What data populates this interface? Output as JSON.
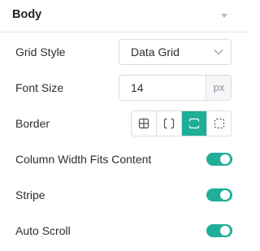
{
  "panel": {
    "title": "Body",
    "collapse_icon": "caret-down-icon"
  },
  "grid_style": {
    "label": "Grid Style",
    "value": "Data Grid",
    "icon": "chevron-down-icon"
  },
  "font_size": {
    "label": "Font Size",
    "value": "14",
    "unit": "px"
  },
  "border": {
    "label": "Border",
    "options": [
      {
        "icon": "border-all-icon",
        "active": false
      },
      {
        "icon": "border-vertical-icon",
        "active": false
      },
      {
        "icon": "border-horizontal-icon",
        "active": true
      },
      {
        "icon": "border-none-icon",
        "active": false
      }
    ]
  },
  "column_width_fits_content": {
    "label": "Column Width Fits Content",
    "enabled": true
  },
  "stripe": {
    "label": "Stripe",
    "enabled": true
  },
  "auto_scroll": {
    "label": "Auto Scroll",
    "enabled": true
  },
  "colors": {
    "accent": "#1fae97",
    "border": "#dcdee2",
    "text": "#2b2f33"
  }
}
